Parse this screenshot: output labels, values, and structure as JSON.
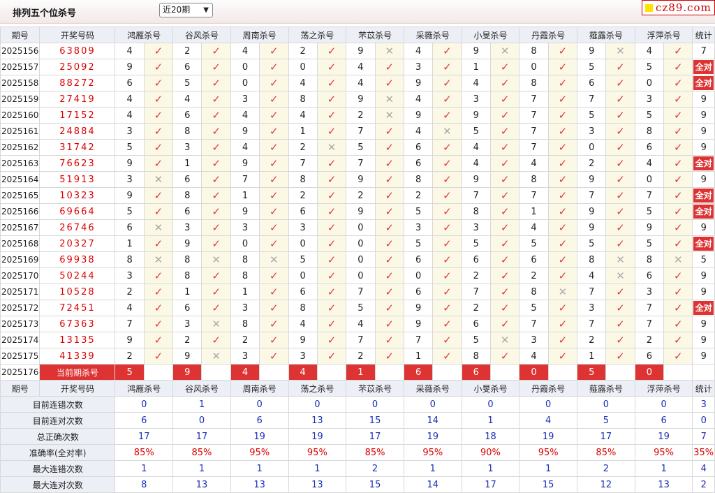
{
  "page": {
    "title": "排列五个位杀号",
    "period_select": "近20期",
    "logo_text": "cz89.com"
  },
  "columns": {
    "issue": "期号",
    "draw": "开奖号码",
    "experts": [
      "鸿雁杀号",
      "谷风杀号",
      "周南杀号",
      "荡之杀号",
      "芣苡杀号",
      "采薇杀号",
      "小旻杀号",
      "丹霞杀号",
      "薤露杀号",
      "浮萍杀号"
    ],
    "stat": "统计"
  },
  "all_correct_label": "全对",
  "rows": [
    {
      "issue": "2025156",
      "draw": "63809",
      "kills": [
        "4",
        "2",
        "4",
        "2",
        "9",
        "4",
        "9",
        "8",
        "9",
        "4"
      ],
      "hits": [
        1,
        1,
        1,
        1,
        0,
        1,
        0,
        1,
        0,
        1
      ],
      "stat": "7"
    },
    {
      "issue": "2025157",
      "draw": "25092",
      "kills": [
        "9",
        "6",
        "0",
        "0",
        "4",
        "3",
        "1",
        "0",
        "5",
        "5"
      ],
      "hits": [
        1,
        1,
        1,
        1,
        1,
        1,
        1,
        1,
        1,
        1
      ],
      "stat": "全对"
    },
    {
      "issue": "2025158",
      "draw": "88272",
      "kills": [
        "6",
        "5",
        "0",
        "4",
        "4",
        "9",
        "4",
        "8",
        "6",
        "0"
      ],
      "hits": [
        1,
        1,
        1,
        1,
        1,
        1,
        1,
        1,
        1,
        1
      ],
      "stat": "全对"
    },
    {
      "issue": "2025159",
      "draw": "27419",
      "kills": [
        "4",
        "4",
        "3",
        "8",
        "9",
        "4",
        "3",
        "7",
        "7",
        "3"
      ],
      "hits": [
        1,
        1,
        1,
        1,
        0,
        1,
        1,
        1,
        1,
        1
      ],
      "stat": "9"
    },
    {
      "issue": "2025160",
      "draw": "17152",
      "kills": [
        "4",
        "6",
        "4",
        "4",
        "2",
        "9",
        "9",
        "7",
        "5",
        "5"
      ],
      "hits": [
        1,
        1,
        1,
        1,
        0,
        1,
        1,
        1,
        1,
        1
      ],
      "stat": "9"
    },
    {
      "issue": "2025161",
      "draw": "24884",
      "kills": [
        "3",
        "8",
        "9",
        "1",
        "7",
        "4",
        "5",
        "7",
        "3",
        "8"
      ],
      "hits": [
        1,
        1,
        1,
        1,
        1,
        0,
        1,
        1,
        1,
        1
      ],
      "stat": "9"
    },
    {
      "issue": "2025162",
      "draw": "31742",
      "kills": [
        "5",
        "3",
        "4",
        "2",
        "5",
        "6",
        "4",
        "7",
        "0",
        "6"
      ],
      "hits": [
        1,
        1,
        1,
        0,
        1,
        1,
        1,
        1,
        1,
        1
      ],
      "stat": "9"
    },
    {
      "issue": "2025163",
      "draw": "76623",
      "kills": [
        "9",
        "1",
        "9",
        "7",
        "7",
        "6",
        "4",
        "4",
        "2",
        "4"
      ],
      "hits": [
        1,
        1,
        1,
        1,
        1,
        1,
        1,
        1,
        1,
        1
      ],
      "stat": "全对"
    },
    {
      "issue": "2025164",
      "draw": "51913",
      "kills": [
        "3",
        "6",
        "7",
        "8",
        "9",
        "8",
        "9",
        "8",
        "9",
        "0"
      ],
      "hits": [
        0,
        1,
        1,
        1,
        1,
        1,
        1,
        1,
        1,
        1
      ],
      "stat": "9"
    },
    {
      "issue": "2025165",
      "draw": "10323",
      "kills": [
        "9",
        "8",
        "1",
        "2",
        "2",
        "2",
        "7",
        "7",
        "7",
        "7"
      ],
      "hits": [
        1,
        1,
        1,
        1,
        1,
        1,
        1,
        1,
        1,
        1
      ],
      "stat": "全对"
    },
    {
      "issue": "2025166",
      "draw": "69664",
      "kills": [
        "5",
        "6",
        "9",
        "6",
        "9",
        "5",
        "8",
        "1",
        "9",
        "5"
      ],
      "hits": [
        1,
        1,
        1,
        1,
        1,
        1,
        1,
        1,
        1,
        1
      ],
      "stat": "全对"
    },
    {
      "issue": "2025167",
      "draw": "26746",
      "kills": [
        "6",
        "3",
        "3",
        "3",
        "0",
        "3",
        "3",
        "4",
        "9",
        "9"
      ],
      "hits": [
        0,
        1,
        1,
        1,
        1,
        1,
        1,
        1,
        1,
        1
      ],
      "stat": "9"
    },
    {
      "issue": "2025168",
      "draw": "20327",
      "kills": [
        "1",
        "9",
        "0",
        "0",
        "0",
        "5",
        "5",
        "5",
        "5",
        "5"
      ],
      "hits": [
        1,
        1,
        1,
        1,
        1,
        1,
        1,
        1,
        1,
        1
      ],
      "stat": "全对"
    },
    {
      "issue": "2025169",
      "draw": "69938",
      "kills": [
        "8",
        "8",
        "8",
        "5",
        "0",
        "6",
        "6",
        "6",
        "8",
        "8"
      ],
      "hits": [
        0,
        0,
        0,
        1,
        1,
        1,
        1,
        1,
        0,
        0
      ],
      "stat": "5"
    },
    {
      "issue": "2025170",
      "draw": "50244",
      "kills": [
        "3",
        "8",
        "8",
        "0",
        "0",
        "0",
        "2",
        "2",
        "4",
        "6"
      ],
      "hits": [
        1,
        1,
        1,
        1,
        1,
        1,
        1,
        1,
        0,
        1
      ],
      "stat": "9"
    },
    {
      "issue": "2025171",
      "draw": "10528",
      "kills": [
        "2",
        "1",
        "1",
        "6",
        "7",
        "6",
        "7",
        "8",
        "7",
        "3"
      ],
      "hits": [
        1,
        1,
        1,
        1,
        1,
        1,
        1,
        0,
        1,
        1
      ],
      "stat": "9"
    },
    {
      "issue": "2025172",
      "draw": "72451",
      "kills": [
        "4",
        "6",
        "3",
        "8",
        "5",
        "9",
        "2",
        "5",
        "3",
        "7"
      ],
      "hits": [
        1,
        1,
        1,
        1,
        1,
        1,
        1,
        1,
        1,
        1
      ],
      "stat": "全对"
    },
    {
      "issue": "2025173",
      "draw": "67363",
      "kills": [
        "7",
        "3",
        "8",
        "4",
        "4",
        "9",
        "6",
        "7",
        "7",
        "7"
      ],
      "hits": [
        1,
        0,
        1,
        1,
        1,
        1,
        1,
        1,
        1,
        1
      ],
      "stat": "9"
    },
    {
      "issue": "2025174",
      "draw": "13135",
      "kills": [
        "9",
        "2",
        "2",
        "9",
        "7",
        "7",
        "5",
        "3",
        "2",
        "2"
      ],
      "hits": [
        1,
        1,
        1,
        1,
        1,
        1,
        0,
        1,
        1,
        1
      ],
      "stat": "9"
    },
    {
      "issue": "2025175",
      "draw": "41339",
      "kills": [
        "2",
        "9",
        "3",
        "3",
        "2",
        "1",
        "8",
        "4",
        "1",
        "6"
      ],
      "hits": [
        1,
        0,
        1,
        1,
        1,
        1,
        1,
        1,
        1,
        1
      ],
      "stat": "9"
    }
  ],
  "current": {
    "issue": "2025176",
    "label": "当前期杀号",
    "kills": [
      "5",
      "9",
      "4",
      "4",
      "1",
      "6",
      "6",
      "0",
      "5",
      "0"
    ]
  },
  "stats": [
    {
      "label": "目前连错次数",
      "values": [
        "0",
        "1",
        "0",
        "0",
        "0",
        "0",
        "0",
        "0",
        "0",
        "0"
      ],
      "stat": "3"
    },
    {
      "label": "目前连对次数",
      "values": [
        "6",
        "0",
        "6",
        "13",
        "15",
        "14",
        "1",
        "4",
        "5",
        "6"
      ],
      "stat": "0"
    },
    {
      "label": "总正确次数",
      "values": [
        "17",
        "17",
        "19",
        "19",
        "17",
        "19",
        "18",
        "19",
        "17",
        "19"
      ],
      "stat": "7"
    },
    {
      "label": "准确率(全对率)",
      "values": [
        "85%",
        "85%",
        "95%",
        "95%",
        "85%",
        "95%",
        "90%",
        "95%",
        "85%",
        "95%"
      ],
      "stat": "35%",
      "rate": true
    },
    {
      "label": "最大连错次数",
      "values": [
        "1",
        "1",
        "1",
        "1",
        "2",
        "1",
        "1",
        "1",
        "2",
        "1"
      ],
      "stat": "4"
    },
    {
      "label": "最大连对次数",
      "values": [
        "8",
        "13",
        "13",
        "13",
        "15",
        "14",
        "17",
        "15",
        "12",
        "13"
      ],
      "stat": "2"
    }
  ]
}
